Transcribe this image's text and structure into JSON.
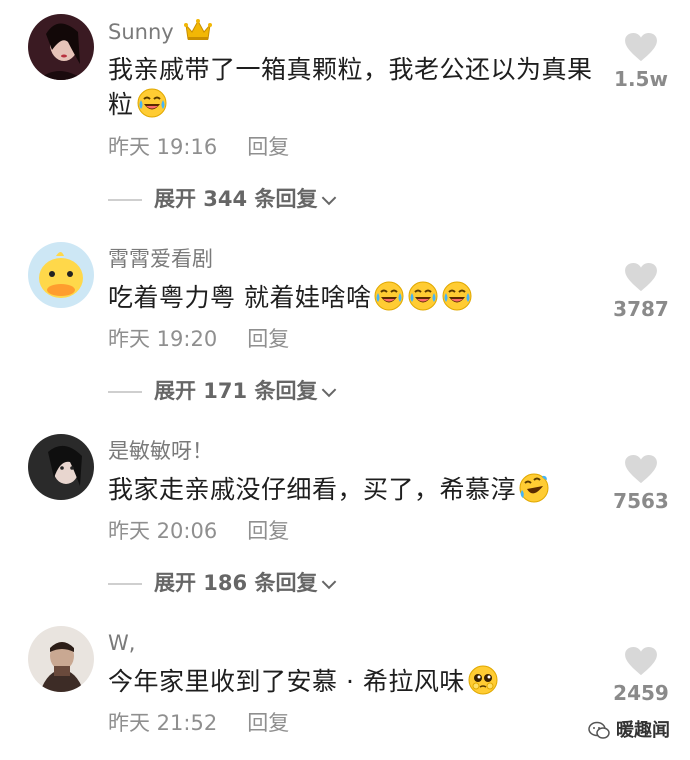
{
  "comments": [
    {
      "username": "Sunny",
      "text": "我亲戚带了一箱真颗粒，我老公还以为真果粒",
      "time": "昨天 19:16",
      "reply_label": "回复",
      "expand_label": "展开 344 条回复",
      "likes": "1.5w",
      "badge_icon": "crown-icon",
      "emojis": [
        "laughing-crying-emoji"
      ]
    },
    {
      "username": "霄霄爱看剧",
      "text": "吃着粤力粤 就着娃啥啥",
      "time": "昨天 19:20",
      "reply_label": "回复",
      "expand_label": "展开 171 条回复",
      "likes": "3787",
      "emojis": [
        "laughing-crying-emoji",
        "laughing-crying-emoji",
        "laughing-crying-emoji"
      ]
    },
    {
      "username": "是敏敏呀！",
      "text": "我家走亲戚没仔细看，买了，希慕淳",
      "time": "昨天 20:06",
      "reply_label": "回复",
      "expand_label": "展开 186 条回复",
      "likes": "7563",
      "emojis": [
        "rolling-laughing-emoji"
      ]
    },
    {
      "username": "W,",
      "text": "今年家里收到了安慕 · 希拉风味",
      "time": "昨天 21:52",
      "reply_label": "回复",
      "likes": "2459",
      "emojis": [
        "pleading-emoji"
      ]
    }
  ],
  "watermark": {
    "text": "暖趣闻",
    "icon": "wechat-icon"
  },
  "colors": {
    "username": "#7a7a7a",
    "text": "#1e1e1e",
    "meta": "#8f8f8f",
    "heart": "#d8d8d8"
  }
}
